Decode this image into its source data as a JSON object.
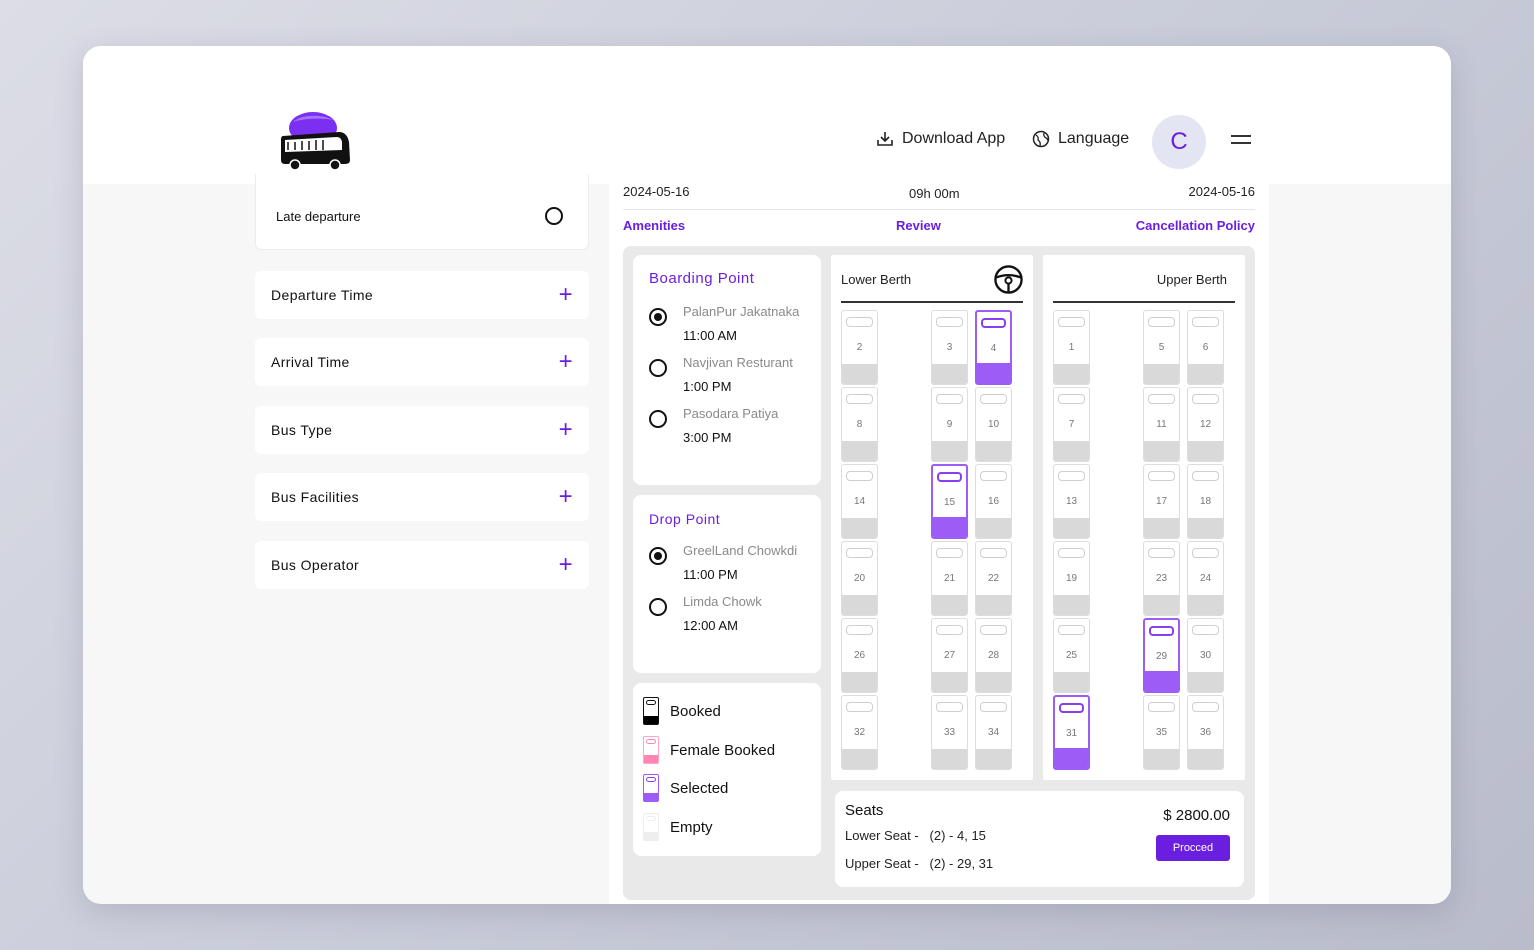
{
  "header": {
    "download_app": "Download App",
    "language": "Language",
    "avatar_initial": "C"
  },
  "filters": {
    "late_departure": "Late departure",
    "items": [
      {
        "label": "Departure Time"
      },
      {
        "label": "Arrival Time"
      },
      {
        "label": "Bus Type"
      },
      {
        "label": "Bus Facilities"
      },
      {
        "label": "Bus Operator"
      }
    ]
  },
  "trip": {
    "depart_date": "2024-05-16",
    "duration": "09h 00m",
    "arrive_date": "2024-05-16",
    "tabs": [
      "Amenities",
      "Review",
      "Cancellation Policy"
    ]
  },
  "boarding": {
    "title": "Boarding Point",
    "points": [
      {
        "name": "PalanPur Jakatnaka",
        "time": "11:00 AM",
        "selected": true
      },
      {
        "name": "Navjivan Resturant",
        "time": "1:00 PM",
        "selected": false
      },
      {
        "name": "Pasodara Patiya",
        "time": "3:00 PM",
        "selected": false
      }
    ]
  },
  "drop": {
    "title": "Drop Point",
    "points": [
      {
        "name": "GreelLand Chowkdi",
        "time": "11:00 PM",
        "selected": true
      },
      {
        "name": "Limda Chowk",
        "time": "12:00 AM",
        "selected": false
      }
    ]
  },
  "legend": {
    "booked": "Booked",
    "female_booked": "Female Booked",
    "selected": "Selected",
    "empty": "Empty"
  },
  "berth": {
    "lower_title": "Lower Berth",
    "upper_title": "Upper Berth",
    "lower_rows": [
      [
        "2",
        "3",
        "4"
      ],
      [
        "8",
        "9",
        "10"
      ],
      [
        "14",
        "15",
        "16"
      ],
      [
        "20",
        "21",
        "22"
      ],
      [
        "26",
        "27",
        "28"
      ],
      [
        "32",
        "33",
        "34"
      ]
    ],
    "upper_rows": [
      [
        "1",
        "5",
        "6"
      ],
      [
        "7",
        "11",
        "12"
      ],
      [
        "13",
        "17",
        "18"
      ],
      [
        "19",
        "23",
        "24"
      ],
      [
        "25",
        "29",
        "30"
      ],
      [
        "31",
        "35",
        "36"
      ]
    ],
    "selected_seats": [
      "4",
      "15",
      "29",
      "31"
    ]
  },
  "summary": {
    "seats_title": "Seats",
    "price": "$ 2800.00",
    "lower_label": "Lower Seat -",
    "lower_value": "(2) - 4, 15",
    "upper_label": "Upper Seat -",
    "upper_value": "(2) - 29, 31",
    "proceed": "Procced"
  },
  "colors": {
    "accent": "#6a1fe0",
    "selected": "#9d5cf5",
    "female": "#ff86b4",
    "booked": "#000000"
  }
}
